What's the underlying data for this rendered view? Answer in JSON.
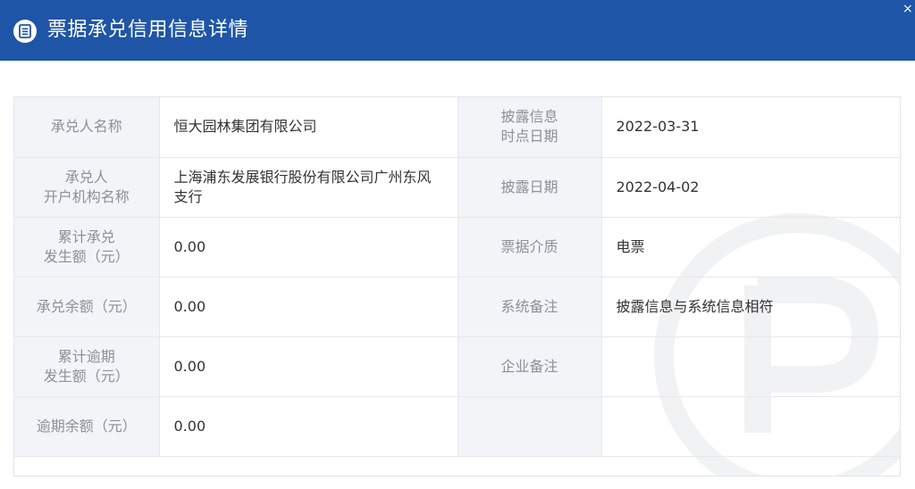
{
  "header": {
    "title": "票据承兑信用信息详情",
    "icon": "document-list-icon",
    "close_label": "×",
    "background": "#1f55a6"
  },
  "rows": [
    {
      "left_label": [
        "承兑人名称"
      ],
      "left_value": "恒大园林集团有限公司",
      "right_label": [
        "披露信息",
        "时点日期"
      ],
      "right_value": "2022-03-31"
    },
    {
      "left_label": [
        "承兑人",
        "开户机构名称"
      ],
      "left_value": "上海浦东发展银行股份有限公司广州东风支行",
      "right_label": [
        "披露日期"
      ],
      "right_value": "2022-04-02"
    },
    {
      "left_label": [
        "累计承兑",
        "发生额（元）"
      ],
      "left_value": "0.00",
      "right_label": [
        "票据介质"
      ],
      "right_value": "电票"
    },
    {
      "left_label": [
        "承兑余额（元）"
      ],
      "left_value": "0.00",
      "right_label": [
        "系统备注"
      ],
      "right_value": "披露信息与系统信息相符"
    },
    {
      "left_label": [
        "累计逾期",
        "发生额（元）"
      ],
      "left_value": "0.00",
      "right_label": [
        "企业备注"
      ],
      "right_value": ""
    },
    {
      "left_label": [
        "逾期余额（元）"
      ],
      "left_value": "0.00",
      "right_label": [
        ""
      ],
      "right_value": ""
    }
  ]
}
